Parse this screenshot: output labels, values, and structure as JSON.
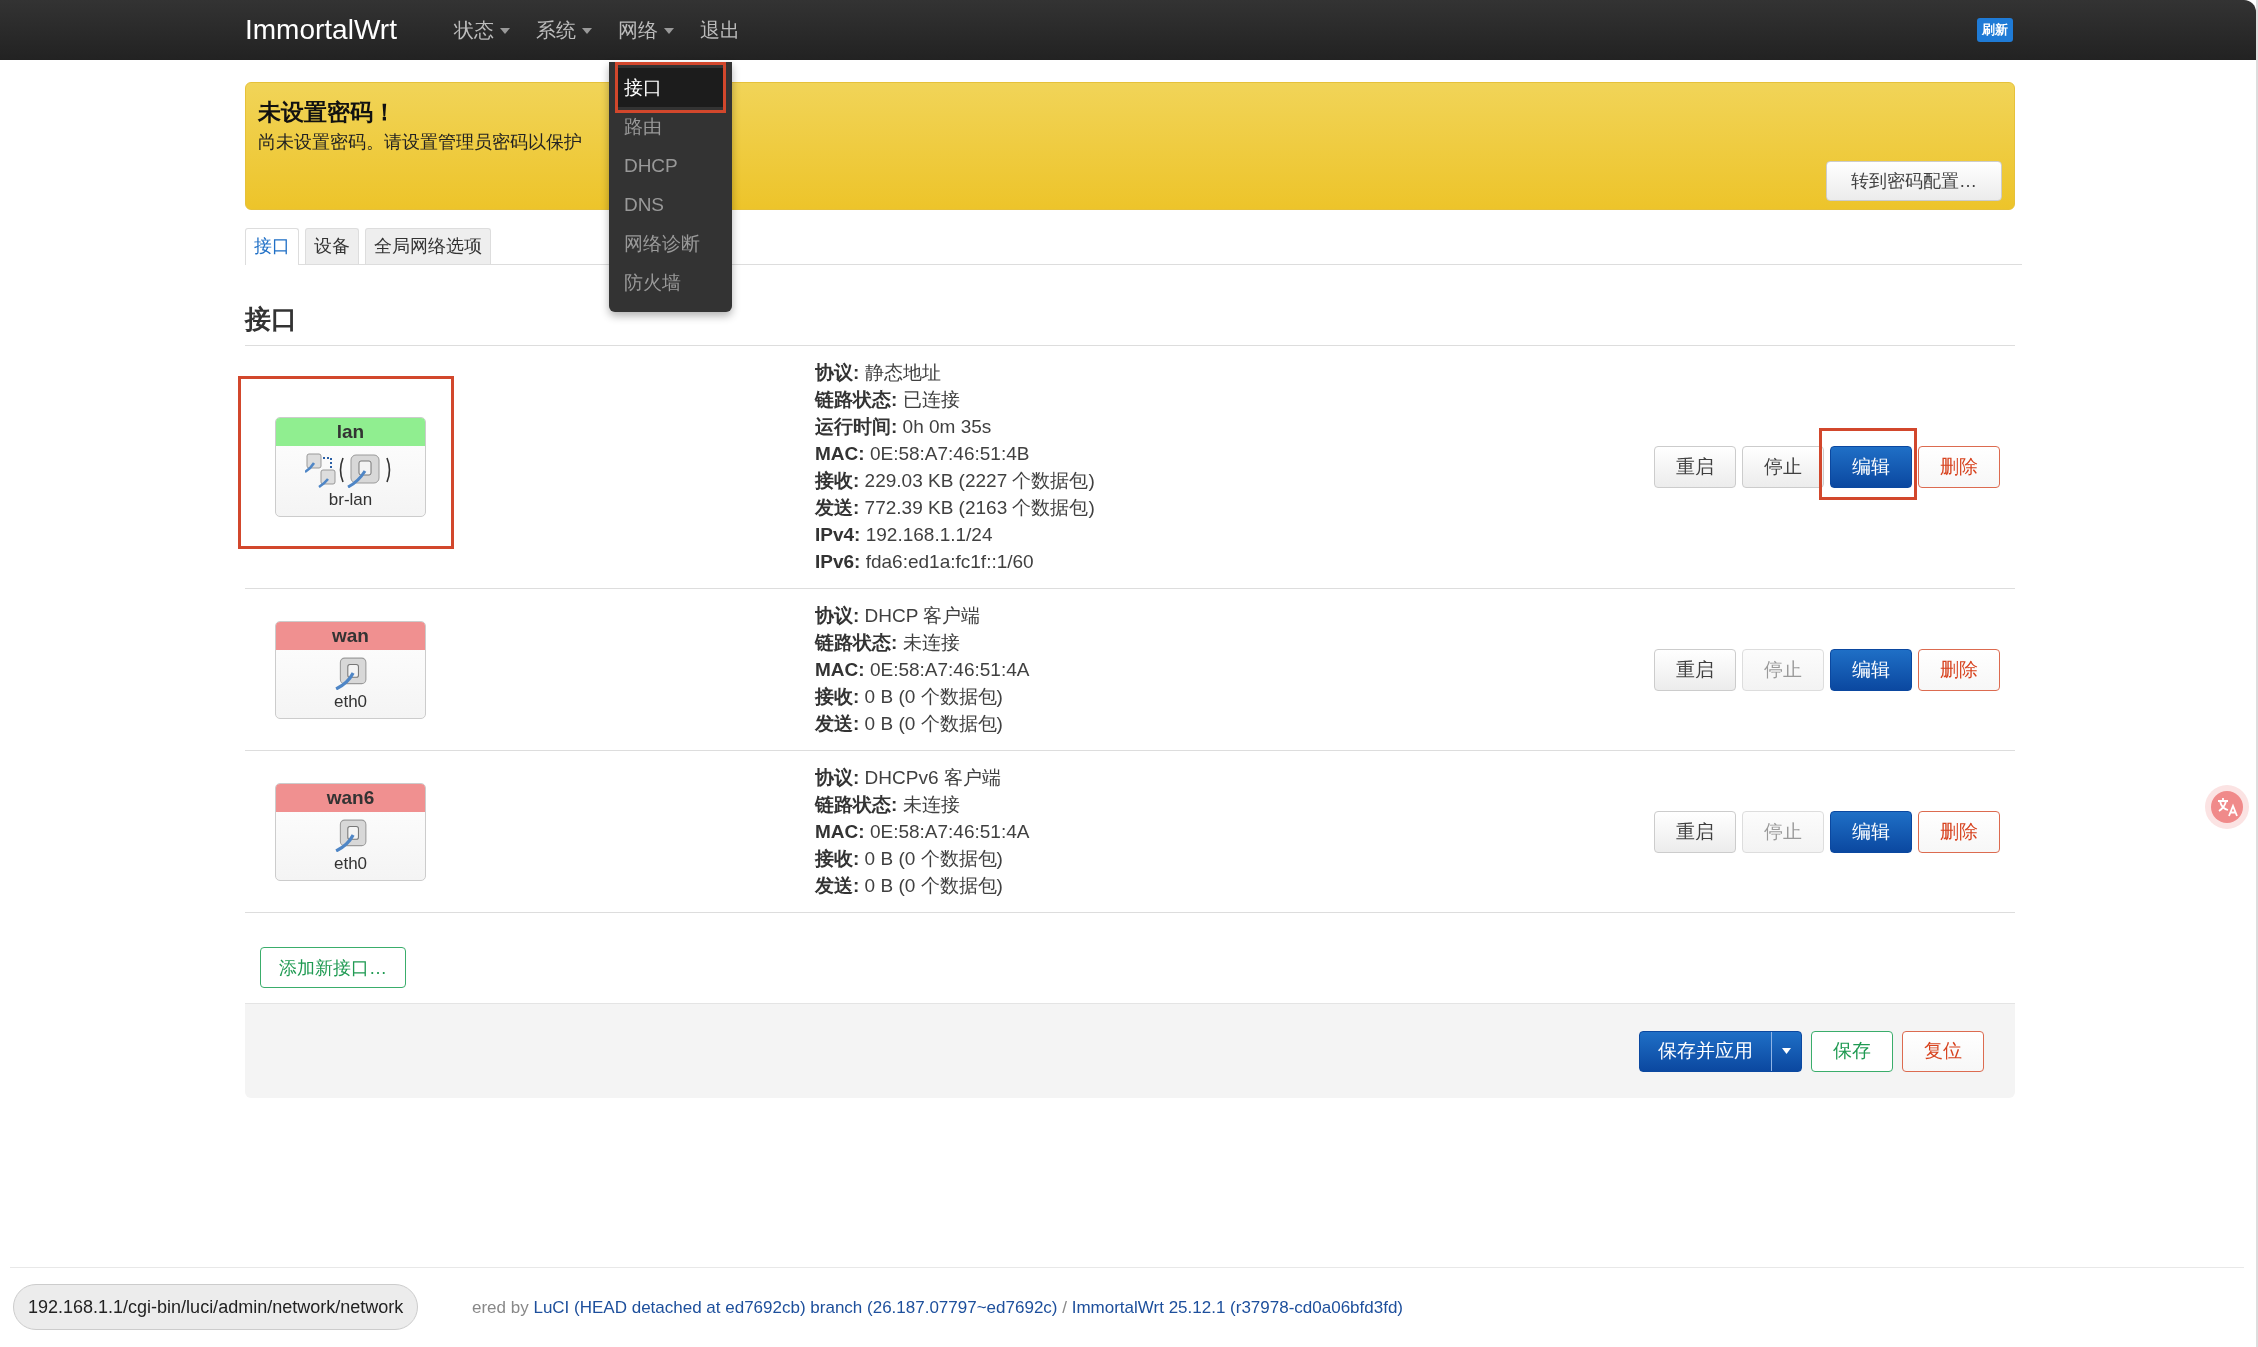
{
  "navbar": {
    "brand": "ImmortalWrt",
    "menu": [
      {
        "label": "状态",
        "caret": true
      },
      {
        "label": "系统",
        "caret": true
      },
      {
        "label": "网络",
        "caret": true,
        "items": [
          {
            "label": "接口",
            "highlighted": true,
            "annotated": true
          },
          {
            "label": "路由",
            "highlighted": false
          },
          {
            "label": "DHCP",
            "highlighted": false
          },
          {
            "label": "DNS",
            "highlighted": false
          },
          {
            "label": "网络诊断",
            "highlighted": false
          },
          {
            "label": "防火墙",
            "highlighted": false
          }
        ]
      },
      {
        "label": "退出",
        "caret": false
      }
    ],
    "refresh_badge": "刷新"
  },
  "alert": {
    "title": "未设置密码！",
    "text": "尚未设置密码。请设置管理员密码以保护",
    "button": "转到密码配置…"
  },
  "tabs": [
    {
      "label": "接口",
      "selected": true
    },
    {
      "label": "设备",
      "selected": false
    },
    {
      "label": "全局网络选项",
      "selected": false
    }
  ],
  "section_title": "接口",
  "interfaces": [
    {
      "name": "lan",
      "color": "#90ee90",
      "kind": "bridge",
      "device": "br-lan",
      "annotated": true,
      "details": [
        "**协议:** 静态地址",
        "**链路状态:** 已连接",
        "**运行时间:** 0h 0m 35s",
        "**MAC:** 0E:58:A7:46:51:4B",
        "**接收:** 229.03 KB (2227 个数据包)",
        "**发送:** 772.39 KB (2163 个数据包)",
        "**IPv4:** 192.168.1.1/24",
        "**IPv6:** fda6:ed1a:fc1f::1/60"
      ],
      "buttons": [
        {
          "label": "重启",
          "kind": "default",
          "disabled": false
        },
        {
          "label": "停止",
          "kind": "default",
          "disabled": false
        },
        {
          "label": "编辑",
          "kind": "primary",
          "annotated": true
        },
        {
          "label": "删除",
          "kind": "negative"
        }
      ]
    },
    {
      "name": "wan",
      "color": "#f09090",
      "kind": "port",
      "device": "eth0",
      "details": [
        "**协议:** DHCP 客户端",
        "**链路状态:** 未连接",
        "**MAC:** 0E:58:A7:46:51:4A",
        "**接收:** 0 B (0 个数据包)",
        "**发送:** 0 B (0 个数据包)"
      ],
      "buttons": [
        {
          "label": "重启",
          "kind": "default",
          "disabled": false
        },
        {
          "label": "停止",
          "kind": "default",
          "disabled": true
        },
        {
          "label": "编辑",
          "kind": "primary"
        },
        {
          "label": "删除",
          "kind": "negative"
        }
      ]
    },
    {
      "name": "wan6",
      "color": "#f09090",
      "kind": "port",
      "device": "eth0",
      "details": [
        "**协议:** DHCPv6 客户端",
        "**链路状态:** 未连接",
        "**MAC:** 0E:58:A7:46:51:4A",
        "**接收:** 0 B (0 个数据包)",
        "**发送:** 0 B (0 个数据包)"
      ],
      "buttons": [
        {
          "label": "重启",
          "kind": "default",
          "disabled": false
        },
        {
          "label": "停止",
          "kind": "default",
          "disabled": true
        },
        {
          "label": "编辑",
          "kind": "primary"
        },
        {
          "label": "删除",
          "kind": "negative"
        }
      ]
    }
  ],
  "add_button": "添加新接口…",
  "actions": [
    {
      "label": "保存并应用",
      "kind": "primary",
      "split": true
    },
    {
      "label": "保存",
      "kind": "positive",
      "split": false
    },
    {
      "label": "复位",
      "kind": "negative",
      "split": false
    }
  ],
  "footer": {
    "parts": [
      {
        "text": "ered by ",
        "kind": "plain"
      },
      {
        "text": "LuCI (HEAD detached at ed7692cb) branch (26.187.07797~ed7692c)",
        "kind": "link"
      },
      {
        "text": " / ",
        "kind": "plain"
      },
      {
        "text": "ImmortalWrt 25.12.1 (r37978-cd0a06bfd3fd)",
        "kind": "link"
      }
    ]
  },
  "status_url": "192.168.1.1/cgi-bin/luci/admin/network/network"
}
